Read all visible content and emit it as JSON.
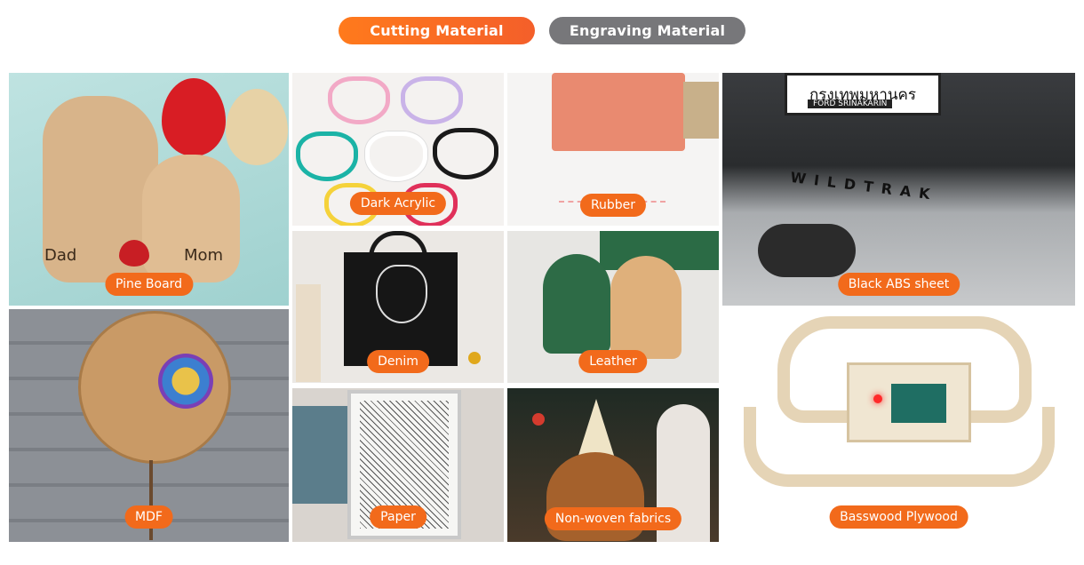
{
  "tabs": {
    "cutting": "Cutting Material",
    "engraving": "Engraving Material"
  },
  "colors": {
    "accent": "#f26a1b",
    "tab_inactive": "#77777a"
  },
  "tiles": {
    "pine_board": {
      "label": "Pine Board",
      "names": [
        "Dad",
        "Mom"
      ]
    },
    "dark_acrylic": {
      "label": "Dark Acrylic"
    },
    "rubber": {
      "label": "Rubber"
    },
    "black_abs_sheet": {
      "label": "Black ABS sheet",
      "plate_text": "กรุงเทพมหานคร",
      "plate_sub": "FORD SRINAKARIN",
      "badge_text": "WILDTRAK"
    },
    "mdf": {
      "label": "MDF"
    },
    "denim": {
      "label": "Denim"
    },
    "leather": {
      "label": "Leather"
    },
    "paper": {
      "label": "Paper"
    },
    "non_woven": {
      "label": "Non-woven fabrics"
    },
    "basswood": {
      "label": "Basswood Plywood"
    }
  }
}
